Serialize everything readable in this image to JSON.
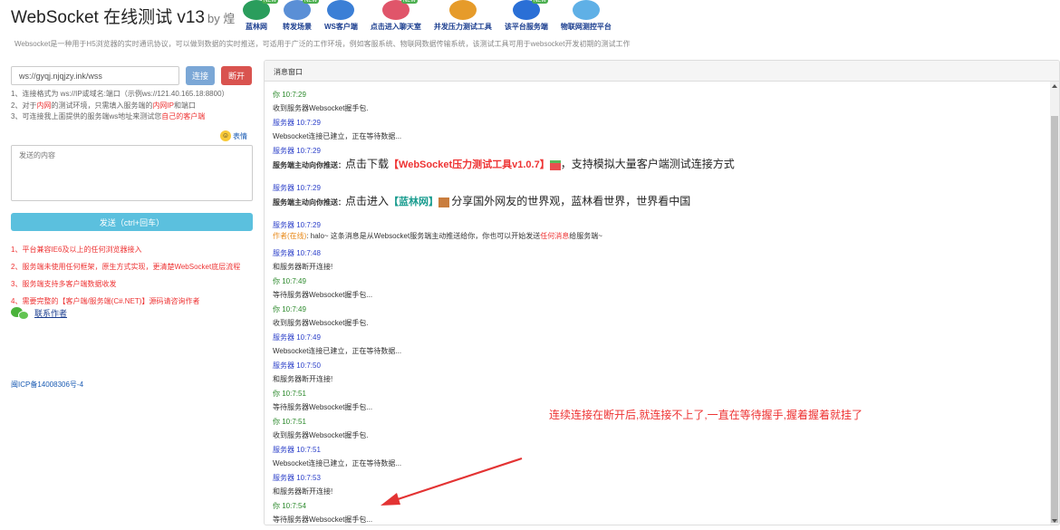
{
  "header": {
    "title": "WebSocket 在线测试 v13",
    "by": "by 煌",
    "description": "Websocket是一种用于H5浏览器的实时通讯协议，可以做到数据的实时推送，可适用于广泛的工作环境，例如客服系统、物联网数据传输系统，该测试工具可用于websocket开发初期的测试工作",
    "nav": [
      {
        "label": "蓝林网",
        "icon": "globe-icon",
        "color": "#2a9d5c",
        "new": true
      },
      {
        "label": "转发场景",
        "icon": "signal-tower-icon",
        "color": "#5a8fd6",
        "new": true
      },
      {
        "label": "WS客户端",
        "icon": "ws-client-icon",
        "color": "#3b7fd6",
        "new": false
      },
      {
        "label": "点击进入聊天室",
        "icon": "chat-people-icon",
        "color": "#e0556a",
        "new": true
      },
      {
        "label": "并发压力测试工具",
        "icon": "pencil-tool-icon",
        "color": "#e69b2a",
        "new": false
      },
      {
        "label": "该平台服务端",
        "icon": "earth-icon",
        "color": "#2a6fd6",
        "new": true
      },
      {
        "label": "物联网测控平台",
        "icon": "cloud-icon",
        "color": "#5fb0e6",
        "new": false
      }
    ],
    "new_badge": "NEW"
  },
  "connection": {
    "url": "ws://gyqj.njqjzy.ink/wss",
    "connect_label": "连接",
    "disconnect_label": "断开"
  },
  "tips": [
    "1、连接格式为 ws://IP或域名:端口（示例ws://121.40.165.18:8800）",
    {
      "a": "2、对于",
      "b": "内网",
      "c": "的测试环境，只需填入服务端的",
      "d": "内网IP",
      "e": "和端口"
    },
    {
      "a": "3、可连接我上面提供的服务端ws地址来测试您",
      "b": "自己的客户端"
    }
  ],
  "emoji_label": "表情",
  "send": {
    "placeholder": "发送的内容",
    "button_label": "发送（ctrl+回车）"
  },
  "notes": [
    "1、平台兼容IE6及以上的任何浏览器接入",
    "2、服务端未使用任何框架，原生方式实现，更清楚WebSocket底层流程",
    "3、服务端支持多客户端数据收发",
    "4、需要完整的【客户端/服务端(C#.NET)】源码请咨询作者"
  ],
  "contact_label": "联系作者",
  "icp": "闽ICP备14008306号-4",
  "messages_panel": {
    "title": "消息窗口",
    "messages": [
      {
        "type": "me",
        "who": "你",
        "time": "10:7:29",
        "text": "收到服务器Websocket握手包."
      },
      {
        "type": "server",
        "who": "服务器",
        "time": "10:7:29",
        "text": "Websocket连接已建立，正在等待数据..."
      },
      {
        "type": "push1",
        "who": "服务器",
        "time": "10:7:29",
        "prefix": "服务端主动向你推送：",
        "lead": "点击下载",
        "link": "【WebSocket压力测试工具v1.0.7】",
        "tail": "，支持模拟大量客户端测试连接方式"
      },
      {
        "type": "push2",
        "who": "服务器",
        "time": "10:7:29",
        "prefix": "服务端主动向你推送：",
        "lead": "点击进入",
        "link": "【蓝林网】",
        "tail": "分享国外网友的世界观，蓝林看世界，世界看中国"
      },
      {
        "type": "online",
        "who": "服务器",
        "time": "10:7:29",
        "tag": "作者(在线)",
        "a": ": halo~ 这条消息是从Websocket服务端主动推送给你，你也可以开始发送",
        "b": "任何消息",
        "c": "给服务端~"
      },
      {
        "type": "server",
        "who": "服务器",
        "time": "10:7:48",
        "text": "和服务器断开连接!"
      },
      {
        "type": "me",
        "who": "你",
        "time": "10:7:49",
        "text": "等待服务器Websocket握手包..."
      },
      {
        "type": "me",
        "who": "你",
        "time": "10:7:49",
        "text": "收到服务器Websocket握手包."
      },
      {
        "type": "server",
        "who": "服务器",
        "time": "10:7:49",
        "text": "Websocket连接已建立，正在等待数据..."
      },
      {
        "type": "server",
        "who": "服务器",
        "time": "10:7:50",
        "text": "和服务器断开连接!"
      },
      {
        "type": "me",
        "who": "你",
        "time": "10:7:51",
        "text": "等待服务器Websocket握手包..."
      },
      {
        "type": "me",
        "who": "你",
        "time": "10:7:51",
        "text": "收到服务器Websocket握手包."
      },
      {
        "type": "server",
        "who": "服务器",
        "time": "10:7:51",
        "text": "Websocket连接已建立，正在等待数据..."
      },
      {
        "type": "server",
        "who": "服务器",
        "time": "10:7:53",
        "text": "和服务器断开连接!"
      },
      {
        "type": "me",
        "who": "你",
        "time": "10:7:54",
        "text": "等待服务器Websocket握手包..."
      }
    ]
  },
  "annotation": "连续连接在断开后,就连接不上了,一直在等待握手,握着握着就挂了",
  "colors": {
    "accent": "#5bc0de",
    "danger": "#d9534f",
    "arrow": "#e33333"
  }
}
